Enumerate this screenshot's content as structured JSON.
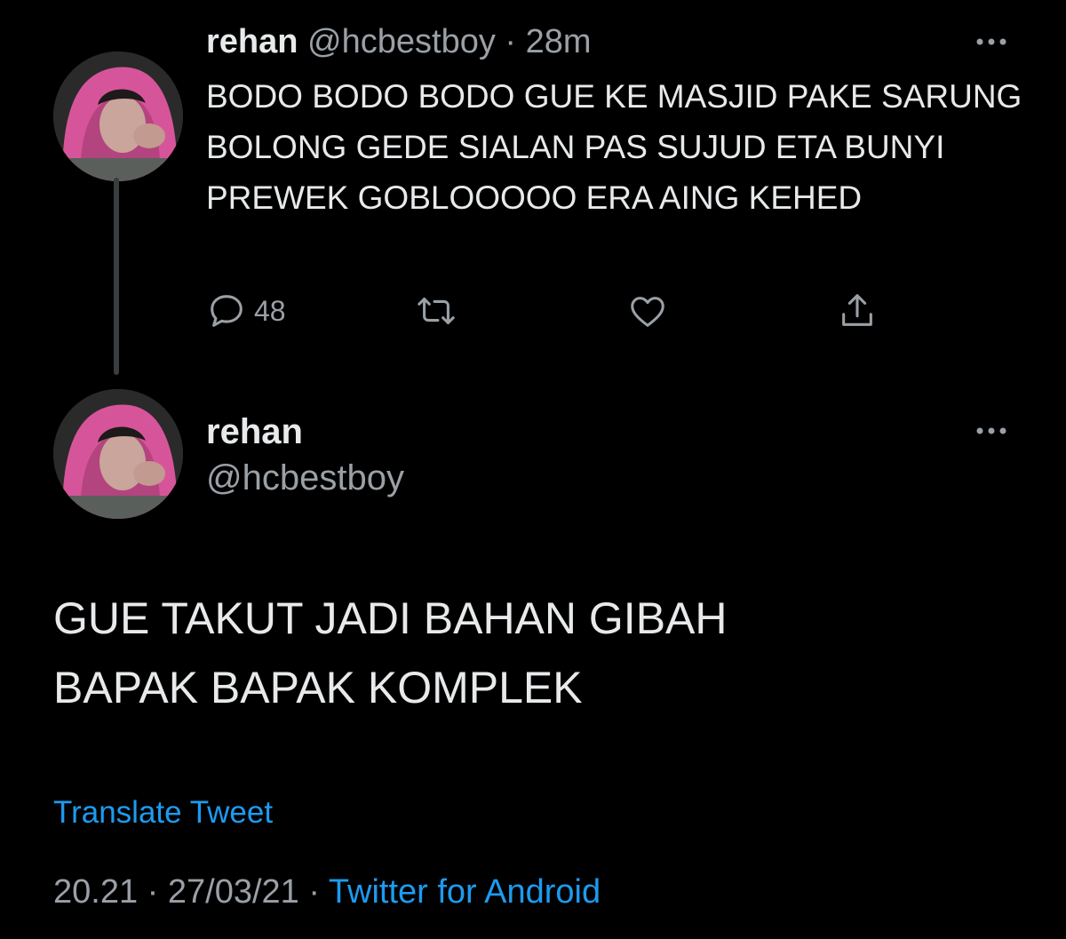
{
  "colors": {
    "background": "#000000",
    "text": "#e7e9ea",
    "secondary": "#9aa0a6",
    "link": "#1d9bf0",
    "thread_line": "#3a3d40",
    "hood_pink": "#d6559a"
  },
  "reply_tweet": {
    "name": "rehan",
    "handle": "@hcbestboy",
    "separator": "·",
    "time": "28m",
    "text": "BODO BODO BODO GUE KE MASJID PAKE SARUNG BOLONG GEDE SIALAN PAS SUJUD ETA BUNYI PREWEK GOBLOOOOO ERA AING KEHED",
    "actions": {
      "reply_icon": "reply-icon",
      "reply_count": "48",
      "retweet_icon": "retweet-icon",
      "like_icon": "heart-icon",
      "share_icon": "share-icon"
    },
    "more_icon": "more-icon"
  },
  "main_tweet": {
    "name": "rehan",
    "handle": "@hcbestboy",
    "text_line1": "GUE TAKUT JADI BAHAN GIBAH",
    "text_line2": "BAPAK BAPAK KOMPLEK",
    "translate_label": "Translate Tweet",
    "time": "20.21",
    "separator": "·",
    "date": "27/03/21",
    "source": "Twitter for Android",
    "more_icon": "more-icon"
  }
}
